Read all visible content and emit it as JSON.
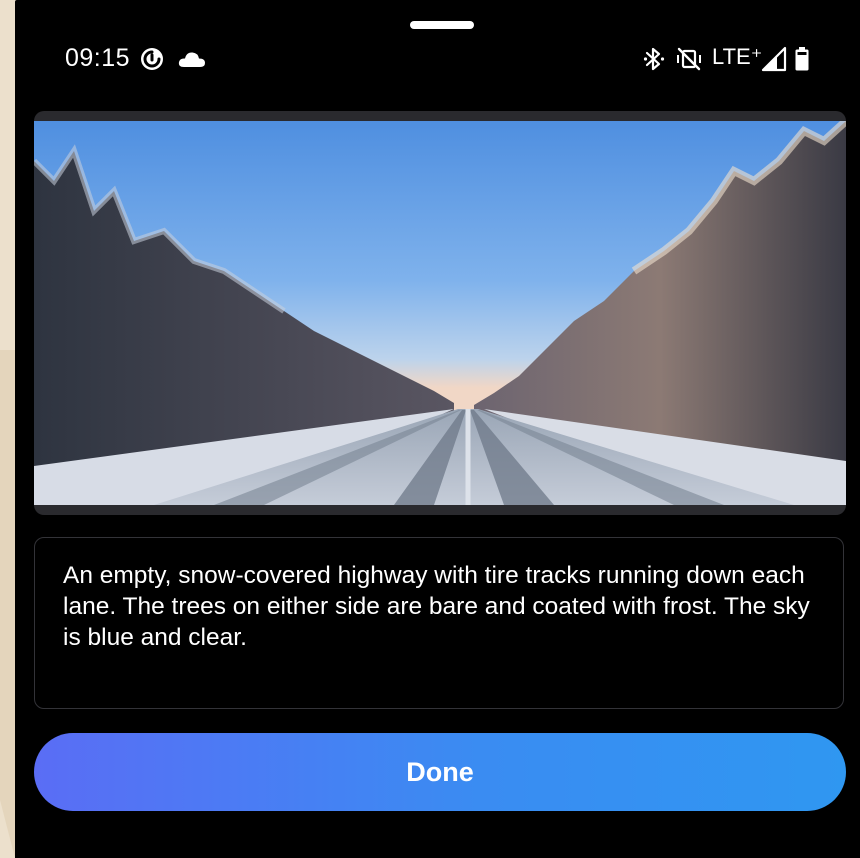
{
  "status_bar": {
    "time": "09:15",
    "network": "LTE⁺"
  },
  "image": {
    "alt_text": "An empty, snow-covered highway with tire tracks running down each lane. The trees on either side are bare and coated with frost. The sky is blue and clear."
  },
  "caption": {
    "text": "An empty, snow-covered highway with tire tracks running down each lane. The trees on either side are bare and coated with frost. The sky is blue and clear."
  },
  "done_button": {
    "label": "Done"
  },
  "colors": {
    "background": "#000000",
    "accent_start": "#5a6df5",
    "accent_end": "#2f97f1",
    "text": "#ffffff"
  }
}
